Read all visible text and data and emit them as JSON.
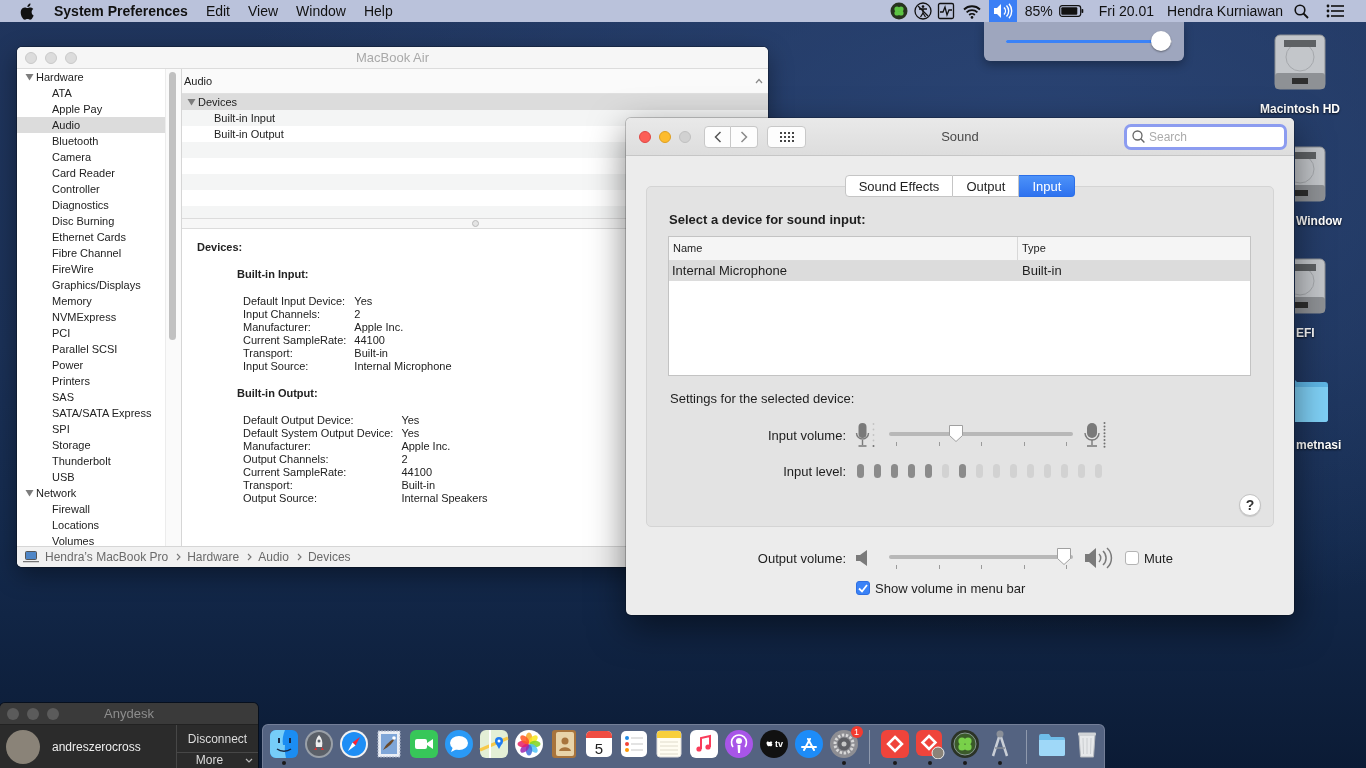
{
  "menu_bar": {
    "app_name": "System Preferences",
    "menus": [
      "Edit",
      "View",
      "Window",
      "Help"
    ],
    "battery": "85%",
    "clock": "Fri 20.01",
    "user": "Hendra Kurniawan"
  },
  "volume_menu": {
    "open": true,
    "level": 0.98
  },
  "desktop_icons": [
    {
      "kind": "drive",
      "label": "Macintosh HD"
    },
    {
      "kind": "drive",
      "label": "Window"
    },
    {
      "kind": "drive",
      "label": "EFI"
    },
    {
      "kind": "folder",
      "label": "metnasi"
    }
  ],
  "info_window": {
    "title": "MacBook Air",
    "active": false,
    "sidebar": [
      {
        "label": "Hardware",
        "expanded": true,
        "selected": false,
        "children": [
          {
            "label": "ATA",
            "selected": false
          },
          {
            "label": "Apple Pay",
            "selected": false
          },
          {
            "label": "Audio",
            "selected": true
          },
          {
            "label": "Bluetooth",
            "selected": false
          },
          {
            "label": "Camera",
            "selected": false
          },
          {
            "label": "Card Reader",
            "selected": false
          },
          {
            "label": "Controller",
            "selected": false
          },
          {
            "label": "Diagnostics",
            "selected": false
          },
          {
            "label": "Disc Burning",
            "selected": false
          },
          {
            "label": "Ethernet Cards",
            "selected": false
          },
          {
            "label": "Fibre Channel",
            "selected": false
          },
          {
            "label": "FireWire",
            "selected": false
          },
          {
            "label": "Graphics/Displays",
            "selected": false
          },
          {
            "label": "Memory",
            "selected": false
          },
          {
            "label": "NVMExpress",
            "selected": false
          },
          {
            "label": "PCI",
            "selected": false
          },
          {
            "label": "Parallel SCSI",
            "selected": false
          },
          {
            "label": "Power",
            "selected": false
          },
          {
            "label": "Printers",
            "selected": false
          },
          {
            "label": "SAS",
            "selected": false
          },
          {
            "label": "SATA/SATA Express",
            "selected": false
          },
          {
            "label": "SPI",
            "selected": false
          },
          {
            "label": "Storage",
            "selected": false
          },
          {
            "label": "Thunderbolt",
            "selected": false
          },
          {
            "label": "USB",
            "selected": false
          }
        ]
      },
      {
        "label": "Network",
        "expanded": true,
        "selected": false,
        "children": [
          {
            "label": "Firewall",
            "selected": false
          },
          {
            "label": "Locations",
            "selected": false
          },
          {
            "label": "Volumes",
            "selected": false
          }
        ]
      }
    ],
    "content_header": "Audio",
    "outline": [
      {
        "label": "Devices",
        "expanded": true,
        "selected": true,
        "children": [
          {
            "label": "Built-in Input",
            "selected": false
          },
          {
            "label": "Built-in Output",
            "selected": false
          }
        ]
      }
    ],
    "details": {
      "heading": "Devices:",
      "sections": [
        {
          "title": "Built-in Input:",
          "rows": [
            {
              "label": "Default Input Device:",
              "value": "Yes"
            },
            {
              "label": "Input Channels:",
              "value": "2"
            },
            {
              "label": "Manufacturer:",
              "value": "Apple Inc."
            },
            {
              "label": "Current SampleRate:",
              "value": "44100"
            },
            {
              "label": "Transport:",
              "value": "Built-in"
            },
            {
              "label": "Input Source:",
              "value": "Internal Microphone"
            }
          ]
        },
        {
          "title": "Built-in Output:",
          "rows": [
            {
              "label": "Default Output Device:",
              "value": "Yes"
            },
            {
              "label": "Default System Output Device:",
              "value": "Yes"
            },
            {
              "label": "Manufacturer:",
              "value": "Apple Inc."
            },
            {
              "label": "Output Channels:",
              "value": "2"
            },
            {
              "label": "Current SampleRate:",
              "value": "44100"
            },
            {
              "label": "Transport:",
              "value": "Built-in"
            },
            {
              "label": "Output Source:",
              "value": "Internal Speakers"
            }
          ]
        }
      ]
    },
    "path_bar": [
      "Hendra’s MacBook Pro",
      "Hardware",
      "Audio",
      "Devices"
    ]
  },
  "sound_window": {
    "title": "Sound",
    "active": true,
    "search": {
      "placeholder": "Search",
      "focused": true
    },
    "tabs": [
      {
        "label": "Sound Effects",
        "selected": false
      },
      {
        "label": "Output",
        "selected": false
      },
      {
        "label": "Input",
        "selected": true
      }
    ],
    "device_prompt": "Select a device for sound input:",
    "device_table": {
      "columns": [
        "Name",
        "Type"
      ],
      "rows": [
        {
          "cells": [
            "Internal Microphone",
            "Built-in"
          ],
          "selected": true
        }
      ]
    },
    "settings_label": "Settings for the selected device:",
    "input_volume": {
      "label": "Input volume:",
      "level": 0.35
    },
    "input_level": {
      "label": "Input level:",
      "segments": [
        {
          "on": true
        },
        {
          "on": true
        },
        {
          "on": true
        },
        {
          "on": true
        },
        {
          "on": true
        },
        {
          "on": false
        },
        {
          "on": true
        },
        {
          "on": false
        },
        {
          "on": false
        },
        {
          "on": false
        },
        {
          "on": false
        },
        {
          "on": false
        },
        {
          "on": false
        },
        {
          "on": false
        },
        {
          "on": false
        }
      ]
    },
    "help": "?",
    "output_volume": {
      "label": "Output volume:",
      "level": 0.99
    },
    "mute": {
      "label": "Mute",
      "checked": false
    },
    "show_volume": {
      "label": "Show volume in menu bar",
      "checked": true
    }
  },
  "anydesk": {
    "title": "Anydesk",
    "user": "andreszerocross",
    "buttons": [
      "Disconnect",
      "More"
    ]
  },
  "dock": {
    "sections": [
      {
        "items": [
          {
            "kind": "finder",
            "running": true
          },
          {
            "kind": "launchpad",
            "running": false
          },
          {
            "kind": "safari",
            "running": false
          },
          {
            "kind": "mail",
            "running": false
          },
          {
            "kind": "facetime",
            "running": false
          },
          {
            "kind": "messages",
            "running": false
          },
          {
            "kind": "maps",
            "running": false
          },
          {
            "kind": "photos",
            "running": false
          },
          {
            "kind": "contacts",
            "running": false
          },
          {
            "kind": "calendar",
            "running": false,
            "text": "5"
          },
          {
            "kind": "reminders",
            "running": false
          },
          {
            "kind": "notes",
            "running": false
          },
          {
            "kind": "music",
            "running": false
          },
          {
            "kind": "podcasts",
            "running": false
          },
          {
            "kind": "tv",
            "running": false,
            "text": "tv"
          },
          {
            "kind": "appstore",
            "running": false
          },
          {
            "kind": "preferences",
            "running": true,
            "badge": "1"
          }
        ]
      },
      {
        "items": [
          {
            "kind": "anydesk",
            "running": true
          },
          {
            "kind": "anydeskuser",
            "running": true
          },
          {
            "kind": "clover",
            "running": true
          },
          {
            "kind": "instrument",
            "running": true
          }
        ]
      },
      {
        "items": [
          {
            "kind": "folder",
            "running": false
          },
          {
            "kind": "trash",
            "running": false
          }
        ]
      }
    ]
  }
}
